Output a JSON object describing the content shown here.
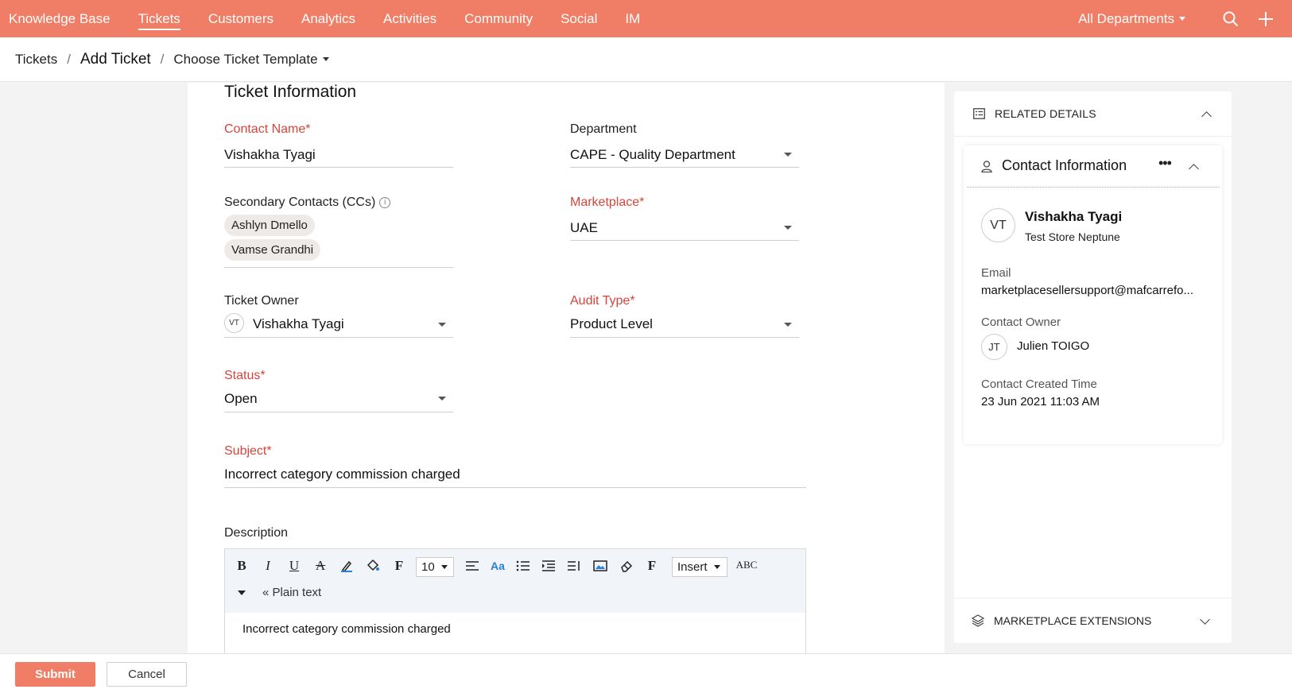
{
  "topnav": {
    "items": [
      "Knowledge Base",
      "Tickets",
      "Customers",
      "Analytics",
      "Activities",
      "Community",
      "Social",
      "IM"
    ],
    "active": "Tickets",
    "department": "All Departments"
  },
  "breadcrumb": {
    "root": "Tickets",
    "current": "Add Ticket",
    "template": "Choose Ticket Template"
  },
  "form": {
    "section_title": "Ticket Information",
    "contact_name": {
      "label": "Contact Name",
      "value": "Vishakha Tyagi"
    },
    "department": {
      "label": "Department",
      "value": "CAPE - Quality Department"
    },
    "secondary_contacts": {
      "label": "Secondary Contacts (CCs)",
      "chips": [
        "Ashlyn Dmello",
        "Vamse Grandhi"
      ]
    },
    "marketplace": {
      "label": "Marketplace",
      "value": "UAE"
    },
    "ticket_owner": {
      "label": "Ticket Owner",
      "initials": "VT",
      "value": "Vishakha Tyagi"
    },
    "audit_type": {
      "label": "Audit Type",
      "value": "Product Level"
    },
    "status": {
      "label": "Status",
      "value": "Open"
    },
    "subject": {
      "label": "Subject",
      "value": "Incorrect category commission charged"
    },
    "description": {
      "label": "Description",
      "font_size": "10",
      "insert_label": "Insert",
      "plain_text": "Plain text",
      "body": "Incorrect category commission charged"
    },
    "required_mark": "*"
  },
  "related": {
    "header": "RELATED DETAILS",
    "card_title": "Contact Information",
    "contact_initials": "VT",
    "contact_name": "Vishakha Tyagi",
    "contact_account": "Test Store Neptune",
    "email_label": "Email",
    "email_value": "marketplacesellersupport@mafcarrefo...",
    "owner_label": "Contact Owner",
    "owner_initials": "JT",
    "owner_name": "Julien TOIGO",
    "created_label": "Contact Created Time",
    "created_value": "23 Jun 2021 11:03 AM",
    "footer": "MARKETPLACE EXTENSIONS"
  },
  "actions": {
    "submit": "Submit",
    "cancel": "Cancel"
  },
  "colors": {
    "brand": "#f07e66",
    "required": "#d9443a"
  }
}
